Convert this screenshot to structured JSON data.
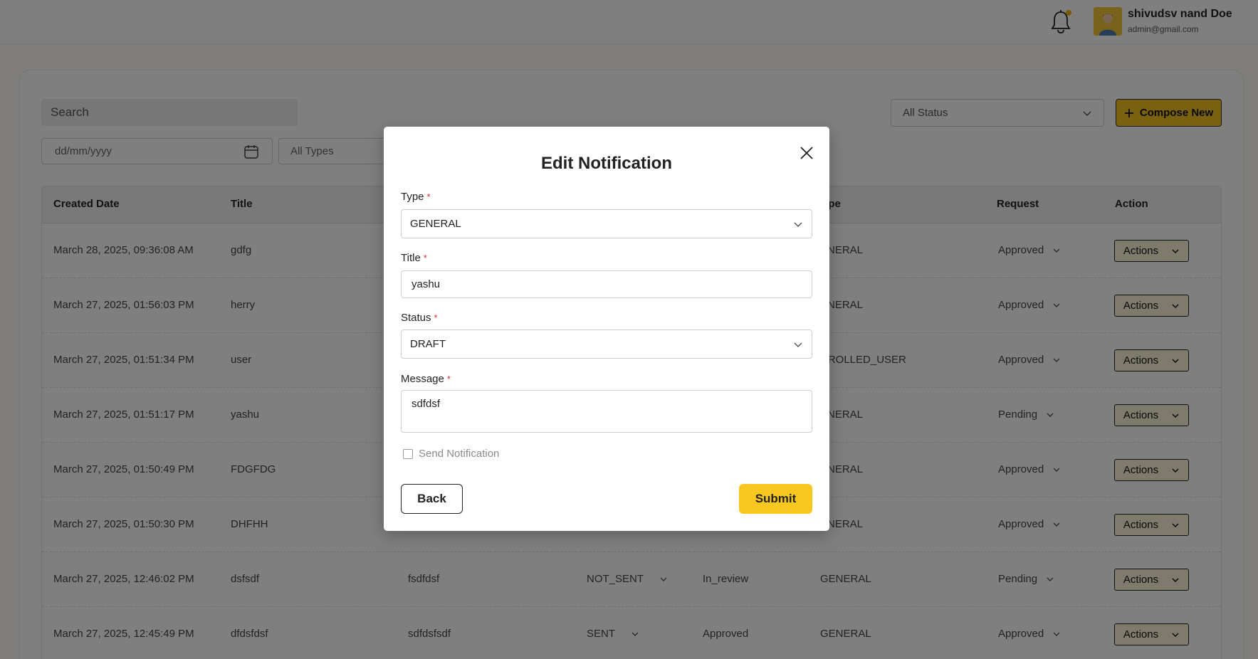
{
  "header": {
    "user_name": "shivudsv nand Doe",
    "user_email": "admin@gmail.com"
  },
  "toolbar": {
    "search_placeholder": "Search",
    "status_filter": "All Status",
    "compose_label": "Compose New",
    "date_placeholder": "dd/mm/yyyy",
    "types_filter": "All Types"
  },
  "table": {
    "headers": {
      "created_date": "Created Date",
      "title": "Title",
      "type": "ype",
      "request": "Request",
      "action": "Action"
    },
    "rows": [
      {
        "created": "March 28, 2025, 09:36:08 AM",
        "title": "gdfg",
        "message": "",
        "status": "",
        "review": "",
        "type": "ENERAL",
        "request": "Approved"
      },
      {
        "created": "March 27, 2025, 01:56:03 PM",
        "title": "herry",
        "message": "",
        "status": "",
        "review": "",
        "type": "ENERAL",
        "request": "Approved"
      },
      {
        "created": "March 27, 2025, 01:51:34 PM",
        "title": "user",
        "message": "",
        "status": "",
        "review": "",
        "type": "NROLLED_USER",
        "request": "Approved"
      },
      {
        "created": "March 27, 2025, 01:51:17 PM",
        "title": "yashu",
        "message": "",
        "status": "",
        "review": "",
        "type": "ENERAL",
        "request": "Pending"
      },
      {
        "created": "March 27, 2025, 01:50:49 PM",
        "title": "FDGFDG",
        "message": "",
        "status": "",
        "review": "",
        "type": "ENERAL",
        "request": "Approved"
      },
      {
        "created": "March 27, 2025, 01:50:30 PM",
        "title": "DHFHH",
        "message": "",
        "status": "",
        "review": "",
        "type": "ENERAL",
        "request": "Approved"
      },
      {
        "created": "March 27, 2025, 12:46:02 PM",
        "title": "dsfsdf",
        "message": "fsdfdsf",
        "status": "NOT_SENT",
        "review": "In_review",
        "type": "GENERAL",
        "request": "Pending"
      },
      {
        "created": "March 27, 2025, 12:45:49 PM",
        "title": "dfdsfdsf",
        "message": "sdfdsfsdf",
        "status": "SENT",
        "review": "Approved",
        "type": "GENERAL",
        "request": "Approved"
      }
    ],
    "actions_label": "Actions"
  },
  "modal": {
    "title": "Edit Notification",
    "type_label": "Type",
    "type_value": "GENERAL",
    "title_label": "Title",
    "title_value": "yashu",
    "status_label": "Status",
    "status_value": "DRAFT",
    "message_label": "Message",
    "message_value": "sdfdsf",
    "required_marker": "*",
    "send_notification_label": "Send Notification",
    "back_label": "Back",
    "submit_label": "Submit"
  },
  "colors": {
    "accent": "#f8c820",
    "overlay": "rgba(0,0,0,0.5)",
    "required": "#d32f2f"
  },
  "icons": [
    "bell-icon",
    "avatar",
    "plus-icon",
    "chevron-down-icon",
    "calendar-icon",
    "close-icon"
  ]
}
